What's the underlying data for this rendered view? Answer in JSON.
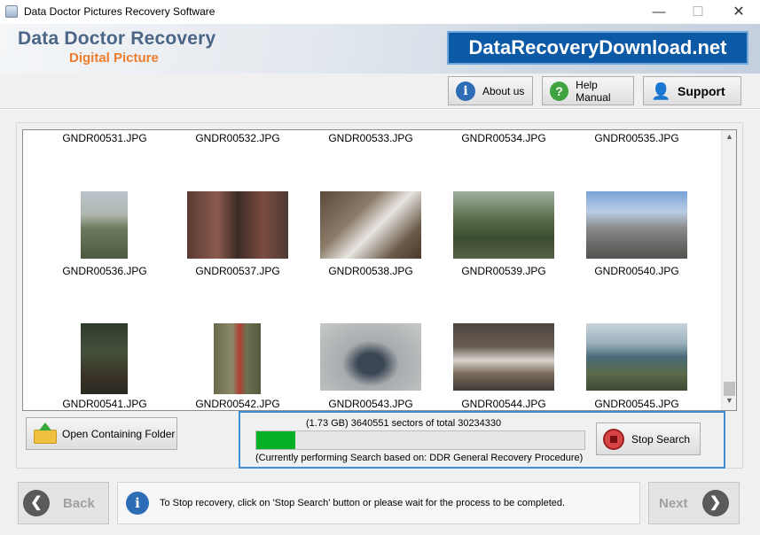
{
  "window": {
    "title": "Data Doctor Pictures Recovery Software",
    "minimize": "—",
    "maximize": "☐",
    "close": "✕"
  },
  "header": {
    "brand_line1": "Data Doctor Recovery",
    "brand_line2": "Digital Picture",
    "site_banner": "DataRecoveryDownload.net"
  },
  "toolbar": {
    "about_label": "About us",
    "help_label": "Help Manual",
    "support_label": "Support",
    "about_icon": "i",
    "help_icon": "?",
    "support_icon": "👤"
  },
  "gallery": {
    "row1_partial": [
      "GNDR00531.JPG",
      "GNDR00532.JPG",
      "GNDR00533.JPG",
      "GNDR00534.JPG",
      "GNDR00535.JPG"
    ],
    "items": [
      {
        "name": "GNDR00536.JPG"
      },
      {
        "name": "GNDR00537.JPG"
      },
      {
        "name": "GNDR00538.JPG"
      },
      {
        "name": "GNDR00539.JPG"
      },
      {
        "name": "GNDR00540.JPG"
      },
      {
        "name": "GNDR00541.JPG"
      },
      {
        "name": "GNDR00542.JPG"
      },
      {
        "name": "GNDR00543.JPG"
      },
      {
        "name": "GNDR00544.JPG"
      },
      {
        "name": "GNDR00545.JPG"
      }
    ]
  },
  "actions": {
    "open_folder_label": "Open Containing Folder"
  },
  "progress": {
    "sectors_text": "(1.73 GB) 3640551  sectors  of  total 30234330",
    "fraction": 0.12,
    "procedure_text": "(Currently performing Search based on:  DDR General Recovery Procedure)",
    "stop_label": "Stop Search",
    "bar_color": "#06b025"
  },
  "footer": {
    "back_label": "Back",
    "next_label": "Next",
    "info_text": "To Stop recovery, click on 'Stop Search' button or please wait for the process to be completed.",
    "back_icon": "❮",
    "next_icon": "❯",
    "info_icon": "i"
  }
}
